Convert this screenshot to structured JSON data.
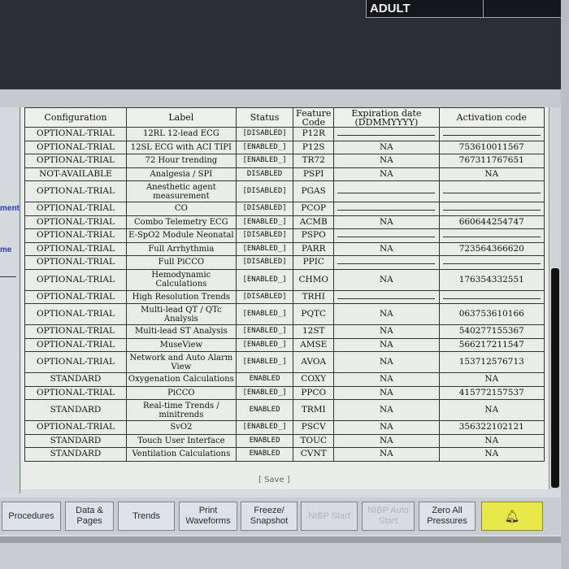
{
  "header": {
    "patient_category": "ADULT"
  },
  "side": {
    "cut_label_1": "ment",
    "cut_label_2": "me"
  },
  "table": {
    "headers": {
      "configuration": "Configuration",
      "label": "Label",
      "status": "Status",
      "feature_code": "Feature Code",
      "expiration": "Expiration date (DDMMYYYY)",
      "activation": "Activation code"
    },
    "rows": [
      {
        "configuration": "OPTIONAL-TRIAL",
        "label": "12RL 12-lead ECG",
        "status": "[DISABLED]",
        "code": "P12R",
        "expiration": "",
        "activation": ""
      },
      {
        "configuration": "OPTIONAL-TRIAL",
        "label": "12SL ECG with ACI TIPI",
        "status": "[ENABLED_]",
        "code": "P12S",
        "expiration": "NA",
        "activation": "753610011567"
      },
      {
        "configuration": "OPTIONAL-TRIAL",
        "label": "72 Hour trending",
        "status": "[ENABLED_]",
        "code": "TR72",
        "expiration": "NA",
        "activation": "767311767651"
      },
      {
        "configuration": "NOT-AVAILABLE",
        "label": "Analgesia / SPI",
        "status": "DISABLED",
        "code": "PSPI",
        "expiration": "NA",
        "activation": "NA"
      },
      {
        "configuration": "OPTIONAL-TRIAL",
        "label": "Anesthetic agent measurement",
        "status": "[DISABLED]",
        "code": "PGAS",
        "expiration": "",
        "activation": ""
      },
      {
        "configuration": "OPTIONAL-TRIAL",
        "label": "CO",
        "status": "[DISABLED]",
        "code": "PCOP",
        "expiration": "",
        "activation": ""
      },
      {
        "configuration": "OPTIONAL-TRIAL",
        "label": "Combo Telemetry ECG",
        "status": "[ENABLED_]",
        "code": "ACMB",
        "expiration": "NA",
        "activation": "660644254747"
      },
      {
        "configuration": "OPTIONAL-TRIAL",
        "label": "E-SpO2 Module Neonatal",
        "status": "[DISABLED]",
        "code": "PSPO",
        "expiration": "",
        "activation": ""
      },
      {
        "configuration": "OPTIONAL-TRIAL",
        "label": "Full Arrhythmia",
        "status": "[ENABLED_]",
        "code": "PARR",
        "expiration": "NA",
        "activation": "723564366620"
      },
      {
        "configuration": "OPTIONAL-TRIAL",
        "label": "Full PiCCO",
        "status": "[DISABLED]",
        "code": "PPIC",
        "expiration": "",
        "activation": ""
      },
      {
        "configuration": "OPTIONAL-TRIAL",
        "label": "Hemodynamic Calculations",
        "status": "[ENABLED_]",
        "code": "CHMO",
        "expiration": "NA",
        "activation": "176354332551"
      },
      {
        "configuration": "OPTIONAL-TRIAL",
        "label": "High Resolution Trends",
        "status": "[DISABLED]",
        "code": "TRHI",
        "expiration": "",
        "activation": ""
      },
      {
        "configuration": "OPTIONAL-TRIAL",
        "label": "Multi-lead QT / QTc Analysis",
        "status": "[ENABLED_]",
        "code": "PQTC",
        "expiration": "NA",
        "activation": "063753610166"
      },
      {
        "configuration": "OPTIONAL-TRIAL",
        "label": "Multi-lead ST Analysis",
        "status": "[ENABLED_]",
        "code": "12ST",
        "expiration": "NA",
        "activation": "540277155367"
      },
      {
        "configuration": "OPTIONAL-TRIAL",
        "label": "MuseView",
        "status": "[ENABLED_]",
        "code": "AMSE",
        "expiration": "NA",
        "activation": "566217211547"
      },
      {
        "configuration": "OPTIONAL-TRIAL",
        "label": "Network and Auto Alarm View",
        "status": "[ENABLED_]",
        "code": "AVOA",
        "expiration": "NA",
        "activation": "153712576713"
      },
      {
        "configuration": "STANDARD",
        "label": "Oxygenation Calculations",
        "status": "ENABLED",
        "code": "COXY",
        "expiration": "NA",
        "activation": "NA"
      },
      {
        "configuration": "OPTIONAL-TRIAL",
        "label": "PiCCO",
        "status": "[ENABLED_]",
        "code": "PPCO",
        "expiration": "NA",
        "activation": "415772157537"
      },
      {
        "configuration": "STANDARD",
        "label": "Real-time Trends / minitrends",
        "status": "ENABLED",
        "code": "TRMI",
        "expiration": "NA",
        "activation": "NA"
      },
      {
        "configuration": "OPTIONAL-TRIAL",
        "label": "SvO2",
        "status": "[ENABLED_]",
        "code": "PSCV",
        "expiration": "NA",
        "activation": "356322102121"
      },
      {
        "configuration": "STANDARD",
        "label": "Touch User Interface",
        "status": "ENABLED",
        "code": "TOUC",
        "expiration": "NA",
        "activation": "NA"
      },
      {
        "configuration": "STANDARD",
        "label": "Ventilation Calculations",
        "status": "ENABLED",
        "code": "CVNT",
        "expiration": "NA",
        "activation": "NA"
      }
    ]
  },
  "save_label": "[ Save ]",
  "buttons": [
    {
      "label": "Procedures",
      "disabled": false
    },
    {
      "label": "Data & Pages",
      "disabled": false
    },
    {
      "label": "Trends",
      "disabled": false
    },
    {
      "label": "Print Waveforms",
      "disabled": false
    },
    {
      "label": "Freeze/ Snapshot",
      "disabled": false
    },
    {
      "label": "NIBP Start",
      "disabled": true
    },
    {
      "label": "NIBP Auto Start",
      "disabled": true
    },
    {
      "label": "Zero All Pressures",
      "disabled": false
    }
  ],
  "alarm_button": {
    "icon": "alarm-bell-icon"
  }
}
